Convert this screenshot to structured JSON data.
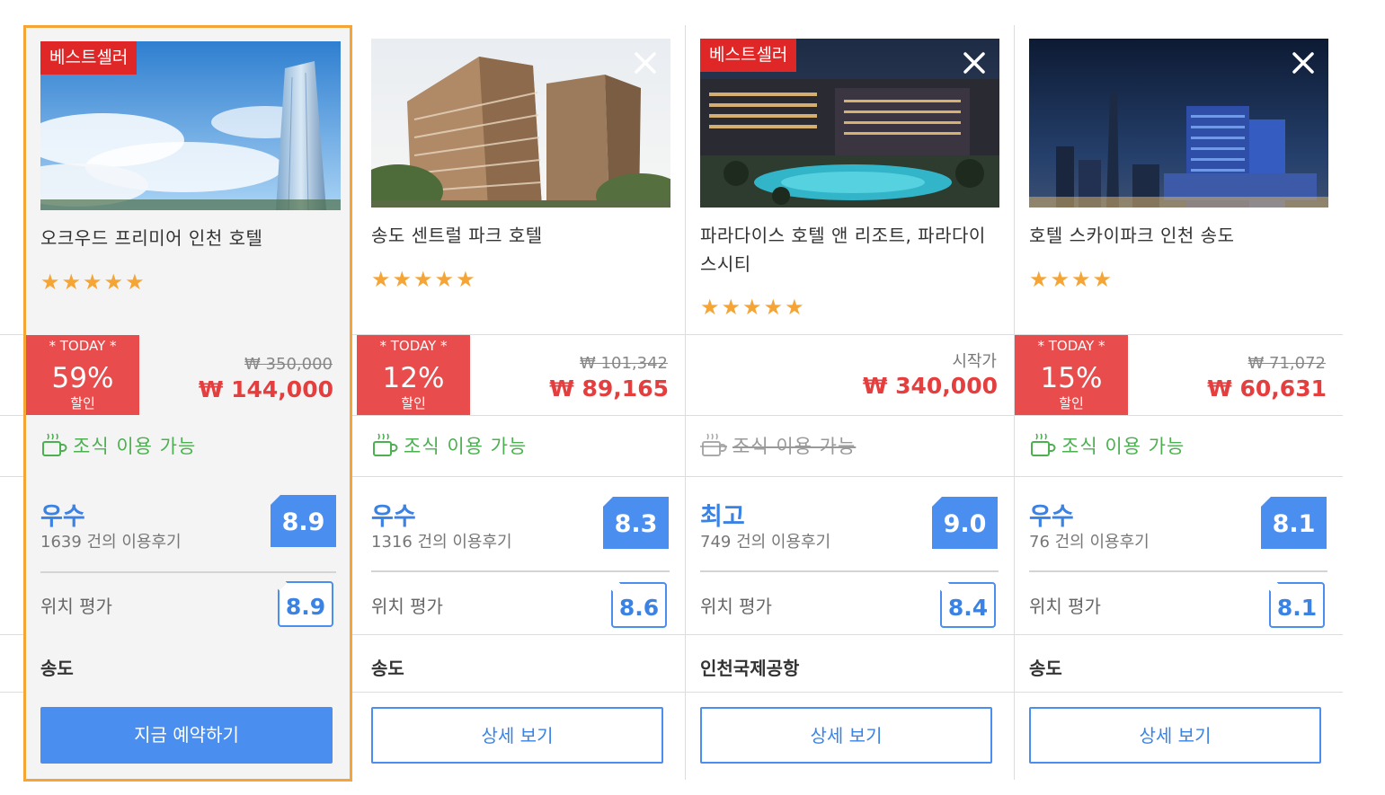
{
  "hotels": [
    {
      "name": "오크우드 프리미어 인천 호텔",
      "badge": "베스트셀러",
      "stars": "★★★★★",
      "today": {
        "label": "* TODAY *",
        "percent": "59%",
        "sale": "할인"
      },
      "old_price": "₩ 350,000",
      "from_label": "",
      "price": "₩ 144,000",
      "breakfast": "조식 이용 가능",
      "breakfast_available": true,
      "rating_word": "우수",
      "reviews": "1639 건의 이용후기",
      "score": "8.9",
      "location_label": "위치 평가",
      "location_score": "8.9",
      "area": "송도",
      "button": "지금 예약하기"
    },
    {
      "name": "송도 센트럴 파크 호텔",
      "badge": "",
      "stars": "★★★★★",
      "today": {
        "label": "* TODAY *",
        "percent": "12%",
        "sale": "할인"
      },
      "old_price": "₩ 101,342",
      "from_label": "",
      "price": "₩ 89,165",
      "breakfast": "조식 이용 가능",
      "breakfast_available": true,
      "rating_word": "우수",
      "reviews": "1316 건의 이용후기",
      "score": "8.3",
      "location_label": "위치 평가",
      "location_score": "8.6",
      "area": "송도",
      "button": "상세 보기"
    },
    {
      "name": "파라다이스 호텔 앤 리조트, 파라다이스시티",
      "badge": "베스트셀러",
      "stars": "★★★★★",
      "today": null,
      "old_price": "",
      "from_label": "시작가",
      "price": "₩ 340,000",
      "breakfast": "조식 이용 가능",
      "breakfast_available": false,
      "rating_word": "최고",
      "reviews": "749 건의 이용후기",
      "score": "9.0",
      "location_label": "위치 평가",
      "location_score": "8.4",
      "area": "인천국제공항",
      "button": "상세 보기"
    },
    {
      "name": "호텔 스카이파크 인천 송도",
      "badge": "",
      "stars": "★★★★",
      "today": {
        "label": "* TODAY *",
        "percent": "15%",
        "sale": "할인"
      },
      "old_price": "₩ 71,072",
      "from_label": "",
      "price": "₩ 60,631",
      "breakfast": "조식 이용 가능",
      "breakfast_available": true,
      "rating_word": "우수",
      "reviews": "76 건의 이용후기",
      "score": "8.1",
      "location_label": "위치 평가",
      "location_score": "8.1",
      "area": "송도",
      "button": "상세 보기"
    }
  ],
  "colors": {
    "accent_blue": "#4a8ef0",
    "sale_red": "#e84c4c",
    "badge_red": "#e02727",
    "price_red": "#e53e3e",
    "breakfast_green": "#4caf50",
    "star_orange": "#f5a536",
    "selected_border": "#f5a536"
  },
  "icons": {
    "close": "close-icon",
    "breakfast": "coffee-cup-icon",
    "star": "star-icon"
  }
}
